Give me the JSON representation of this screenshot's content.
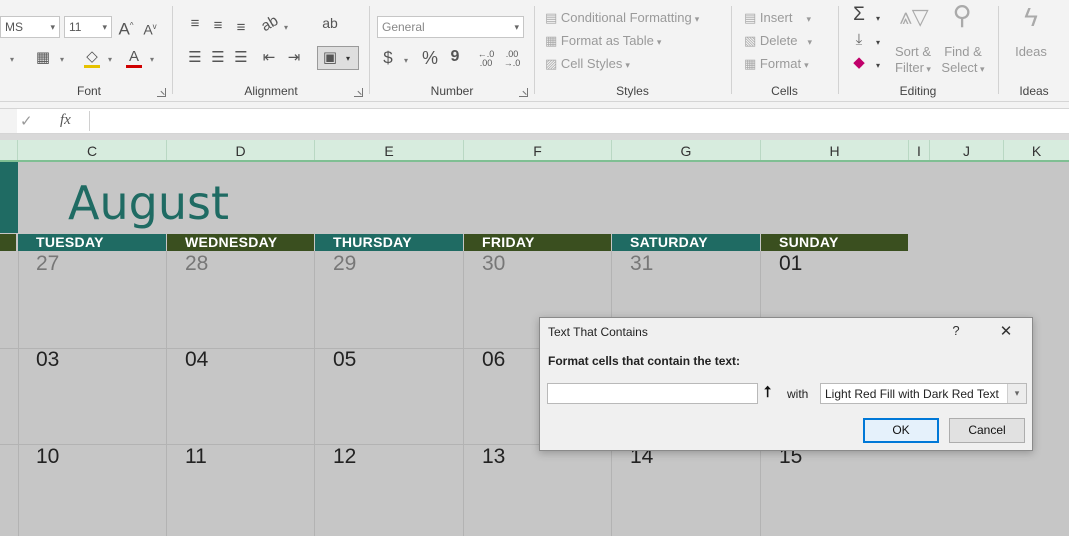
{
  "ribbon": {
    "font": {
      "label": "Font",
      "font_name": "MS",
      "font_size": "11",
      "grow_icon": "A^",
      "shrink_icon": "Av"
    },
    "alignment": {
      "label": "Alignment"
    },
    "number": {
      "label": "Number",
      "format": "General",
      "currency": "$",
      "percent": "%",
      "comma": "9",
      "inc_decimal": "←.0\n.00",
      "dec_decimal": ".00\n→.0"
    },
    "styles": {
      "label": "Styles",
      "conditional_formatting": "Conditional Formatting",
      "format_as_table": "Format as Table",
      "cell_styles": "Cell Styles"
    },
    "cells": {
      "label": "Cells",
      "insert": "Insert",
      "delete": "Delete",
      "format": "Format"
    },
    "editing": {
      "label": "Editing",
      "sort_filter_1": "Sort &",
      "sort_filter_2": "Filter",
      "find_select_1": "Find &",
      "find_select_2": "Select"
    },
    "ideas": {
      "label": "Ideas",
      "button": "Ideas"
    }
  },
  "formula_bar": {
    "check": "✓",
    "fx": "fx",
    "value": ""
  },
  "columns": [
    "C",
    "D",
    "E",
    "F",
    "G",
    "H",
    "I",
    "J",
    "K"
  ],
  "calendar": {
    "month": "August",
    "days": [
      "TUESDAY",
      "WEDNESDAY",
      "THURSDAY",
      "FRIDAY",
      "SATURDAY",
      "SUNDAY"
    ],
    "weeks": [
      [
        "27",
        "28",
        "29",
        "30",
        "31",
        "01"
      ],
      [
        "03",
        "04",
        "05",
        "06",
        "",
        ""
      ],
      [
        "10",
        "11",
        "12",
        "13",
        "14",
        "15"
      ]
    ]
  },
  "dialog": {
    "title": "Text That Contains",
    "help": "?",
    "close": "✕",
    "prompt": "Format cells that contain the text:",
    "input_value": "",
    "ref_icon": "⭡",
    "with_label": "with",
    "format_option": "Light Red Fill with Dark Red Text",
    "ok": "OK",
    "cancel": "Cancel"
  },
  "colors": {
    "teal": "#1f6b63",
    "olive": "#3a4f1f",
    "sheet_bg": "#c6c6c6",
    "accent_blue": "#0078d7"
  }
}
